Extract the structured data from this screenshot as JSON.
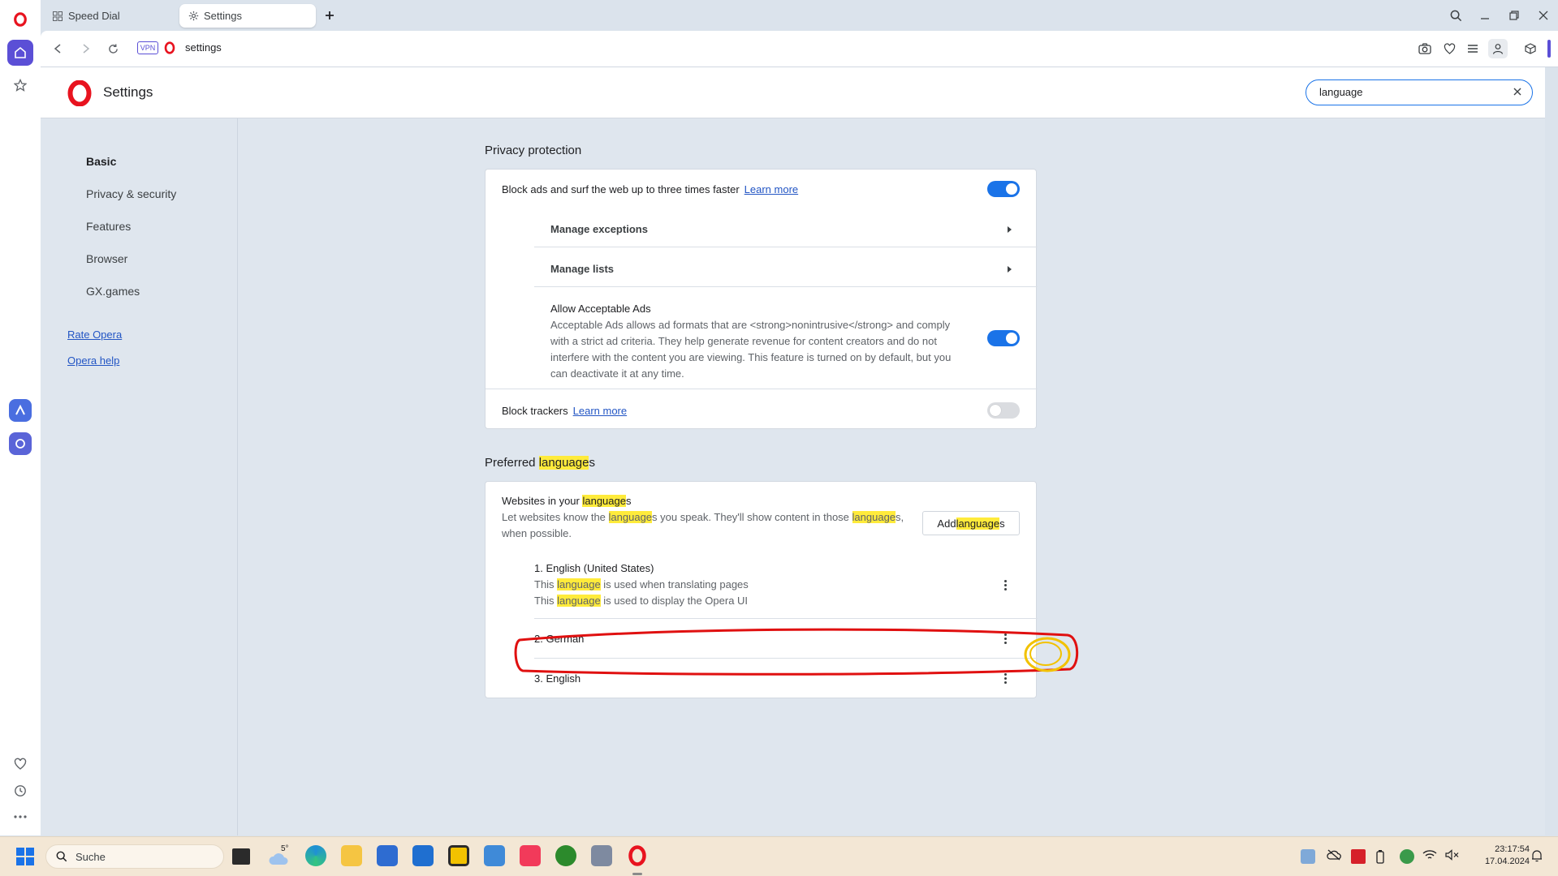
{
  "tabs": [
    {
      "label": "Speed Dial",
      "icon": "speed-dial-icon",
      "active": false
    },
    {
      "label": "Settings",
      "icon": "gear-icon",
      "active": true
    }
  ],
  "address": {
    "vpn_label": "VPN",
    "url": "settings"
  },
  "page_title": "Settings",
  "search": {
    "value": "language"
  },
  "nav": {
    "items": [
      "Basic",
      "Privacy & security",
      "Features",
      "Browser",
      "GX.games"
    ],
    "links": [
      "Rate Opera",
      "Opera help"
    ]
  },
  "privacy": {
    "title": "Privacy protection",
    "block_ads": {
      "label": "Block ads and surf the web up to three times faster",
      "link": "Learn more",
      "enabled": true
    },
    "manage_exceptions": "Manage exceptions",
    "manage_lists": "Manage lists",
    "acceptable_ads": {
      "title": "Allow Acceptable Ads",
      "line1": "Acceptable Ads allows ad formats that are <strong>nonintrusive</strong> and comply",
      "line2": "with a strict ad criteria. They help generate revenue for content creators and do not",
      "line3": "interfere with the content you are viewing. This feature is turned on by default, but you",
      "line4": "can deactivate it at any time.",
      "enabled": true
    },
    "block_trackers": {
      "label": "Block trackers",
      "link": "Learn more",
      "enabled": false
    }
  },
  "languages": {
    "title_pre": "Preferred ",
    "title_hl": "language",
    "title_post": "s",
    "websites": {
      "t_pre": "Websites in your ",
      "t_hl": "language",
      "t_post": "s",
      "d1": "Let websites know the ",
      "d2": "language",
      "d3": "s you speak. They'll show content in those ",
      "d4": "language",
      "d5": "s,",
      "d6": "when possible."
    },
    "add_button": {
      "pre": "Add ",
      "hl": "language",
      "post": "s"
    },
    "list": [
      {
        "name": "1. English (United States)",
        "n1_pre": "This ",
        "n1_hl": "language",
        "n1_post": " is used when translating pages",
        "n2_pre": "This ",
        "n2_hl": "language",
        "n2_post": " is used to display the Opera UI"
      },
      {
        "name": "2. German"
      },
      {
        "name": "3. English"
      }
    ]
  },
  "taskbar": {
    "search_placeholder": "Suche",
    "weather_temp": "5°",
    "clock_time": "23:17:54",
    "clock_date": "17.04.2024"
  },
  "colors": {
    "accent": "#1a73e8",
    "opera_red": "#e8131f",
    "highlight": "#ffeb3b",
    "annotation_red": "#e01010",
    "annotation_yellow": "#f2c200"
  }
}
